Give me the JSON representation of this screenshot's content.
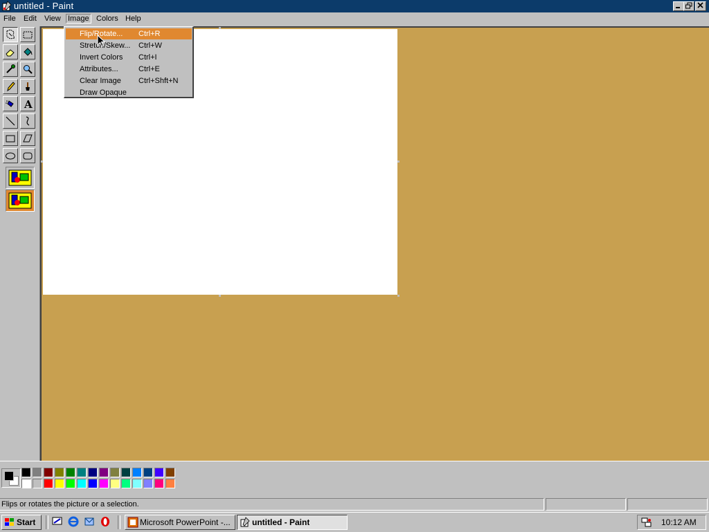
{
  "window": {
    "title": "untitled - Paint"
  },
  "menubar": {
    "items": [
      {
        "label": "File"
      },
      {
        "label": "Edit"
      },
      {
        "label": "View"
      },
      {
        "label": "Image"
      },
      {
        "label": "Colors"
      },
      {
        "label": "Help"
      }
    ]
  },
  "image_menu": {
    "items": [
      {
        "label": "Flip/Rotate...",
        "shortcut": "Ctrl+R",
        "highlighted": true
      },
      {
        "label": "Stretch/Skew...",
        "shortcut": "Ctrl+W"
      },
      {
        "label": "Invert Colors",
        "shortcut": "Ctrl+I"
      },
      {
        "label": "Attributes...",
        "shortcut": "Ctrl+E"
      },
      {
        "label": "Clear Image",
        "shortcut": "Ctrl+Shft+N"
      },
      {
        "label": "Draw Opaque",
        "shortcut": ""
      }
    ]
  },
  "toolbox": {
    "tools": [
      {
        "icon": "free-form-select-icon"
      },
      {
        "icon": "select-icon"
      },
      {
        "icon": "eraser-icon"
      },
      {
        "icon": "fill-bucket-icon"
      },
      {
        "icon": "color-picker-icon"
      },
      {
        "icon": "magnifier-icon"
      },
      {
        "icon": "pencil-icon"
      },
      {
        "icon": "brush-icon"
      },
      {
        "icon": "airbrush-icon"
      },
      {
        "icon": "text-icon"
      },
      {
        "icon": "line-icon"
      },
      {
        "icon": "curve-icon"
      },
      {
        "icon": "rectangle-icon"
      },
      {
        "icon": "polygon-icon"
      },
      {
        "icon": "ellipse-icon"
      },
      {
        "icon": "rounded-rectangle-icon"
      }
    ]
  },
  "palette": {
    "foreground": "#000000",
    "background": "#ffffff",
    "top_row": [
      "#000000",
      "#808080",
      "#800000",
      "#808000",
      "#008000",
      "#008080",
      "#000080",
      "#800080",
      "#808040",
      "#004040",
      "#0080ff",
      "#004080",
      "#4000ff",
      "#804000"
    ],
    "bottom_row": [
      "#ffffff",
      "#c0c0c0",
      "#ff0000",
      "#ffff00",
      "#00ff00",
      "#00ffff",
      "#0000ff",
      "#ff00ff",
      "#ffff80",
      "#00ff80",
      "#80ffff",
      "#8080ff",
      "#ff0080",
      "#ff8040"
    ]
  },
  "status": {
    "text": "Flips or rotates the picture or a selection."
  },
  "taskbar": {
    "start_label": "Start",
    "quick_launch": [
      "show-desktop-icon",
      "internet-explorer-icon",
      "outlook-icon",
      "opera-icon"
    ],
    "tasks": [
      {
        "label": "Microsoft PowerPoint -..."
      },
      {
        "label": "untitled - Paint"
      }
    ],
    "clock": "10:12 AM"
  },
  "colors": {
    "title_bar": "#0c3b6a",
    "workspace": "#c8a050",
    "menu_highlight": "#e08830"
  }
}
